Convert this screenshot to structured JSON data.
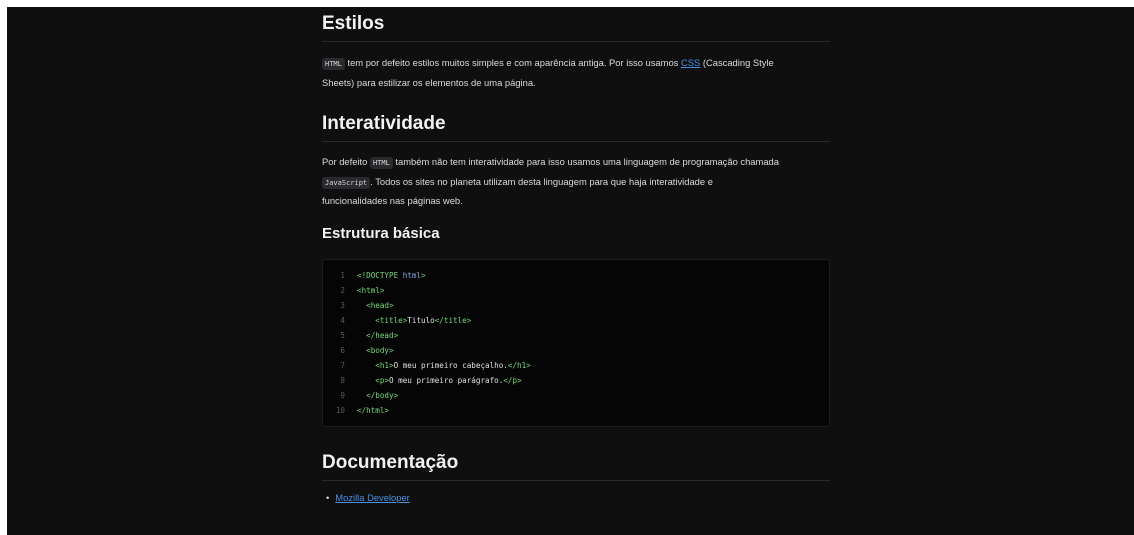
{
  "sections": {
    "estilos": {
      "title": "Estilos",
      "code_html": "HTML",
      "text_1": "tem por defeito estilos muitos simples e com aparência antiga. Por isso usamos",
      "link_css": "CSS",
      "text_2a": "(Cascading Style",
      "text_2b": "Sheets) para estilizar os elementos de uma página."
    },
    "interatividade": {
      "title": "Interatividade",
      "text_1": "Por defeito",
      "code_html": "HTML",
      "text_2": "também não tem interatividade para isso usamos uma linguagem de programação chamada",
      "code_js": "JavaScript",
      "text_3": ". Todos os sites no planeta utilizam desta linguagem para que haja interatividade e",
      "text_4": "funcionalidades nas páginas web."
    },
    "estrutura": {
      "title": "Estrutura básica"
    },
    "documentacao": {
      "title": "Documentação",
      "links": [
        "Mozilla Developer"
      ]
    }
  },
  "code": {
    "line_numbers": [
      "1",
      "2",
      "3",
      "4",
      "5",
      "6",
      "7",
      "8",
      "9",
      "10"
    ],
    "lines": [
      [
        {
          "t": "<!DOCTYPE ",
          "c": "tag"
        },
        {
          "t": "html",
          "c": "kw"
        },
        {
          "t": ">",
          "c": "tag"
        }
      ],
      [
        {
          "t": "<html>",
          "c": "tag"
        }
      ],
      [
        {
          "t": "  <head>",
          "c": "tag"
        }
      ],
      [
        {
          "t": "    <title>",
          "c": "tag"
        },
        {
          "t": "Titulo",
          "c": "txt"
        },
        {
          "t": "</title>",
          "c": "tag"
        }
      ],
      [
        {
          "t": "  </head>",
          "c": "tag"
        }
      ],
      [
        {
          "t": "  <body>",
          "c": "tag"
        }
      ],
      [
        {
          "t": "    <h1>",
          "c": "tag"
        },
        {
          "t": "O meu primeiro cabeçalho.",
          "c": "txt"
        },
        {
          "t": "</h1>",
          "c": "tag"
        }
      ],
      [
        {
          "t": "    <p>",
          "c": "tag"
        },
        {
          "t": "O meu primeiro parágrafo.",
          "c": "txt"
        },
        {
          "t": "</p>",
          "c": "tag"
        }
      ],
      [
        {
          "t": "  </body>",
          "c": "tag"
        }
      ],
      [
        {
          "t": "</html>",
          "c": "tag"
        }
      ]
    ]
  },
  "colors": {
    "background": "#0f0f10",
    "link": "#4a90e2",
    "code_tag": "#78d87a",
    "code_keyword": "#8fa3f0"
  }
}
